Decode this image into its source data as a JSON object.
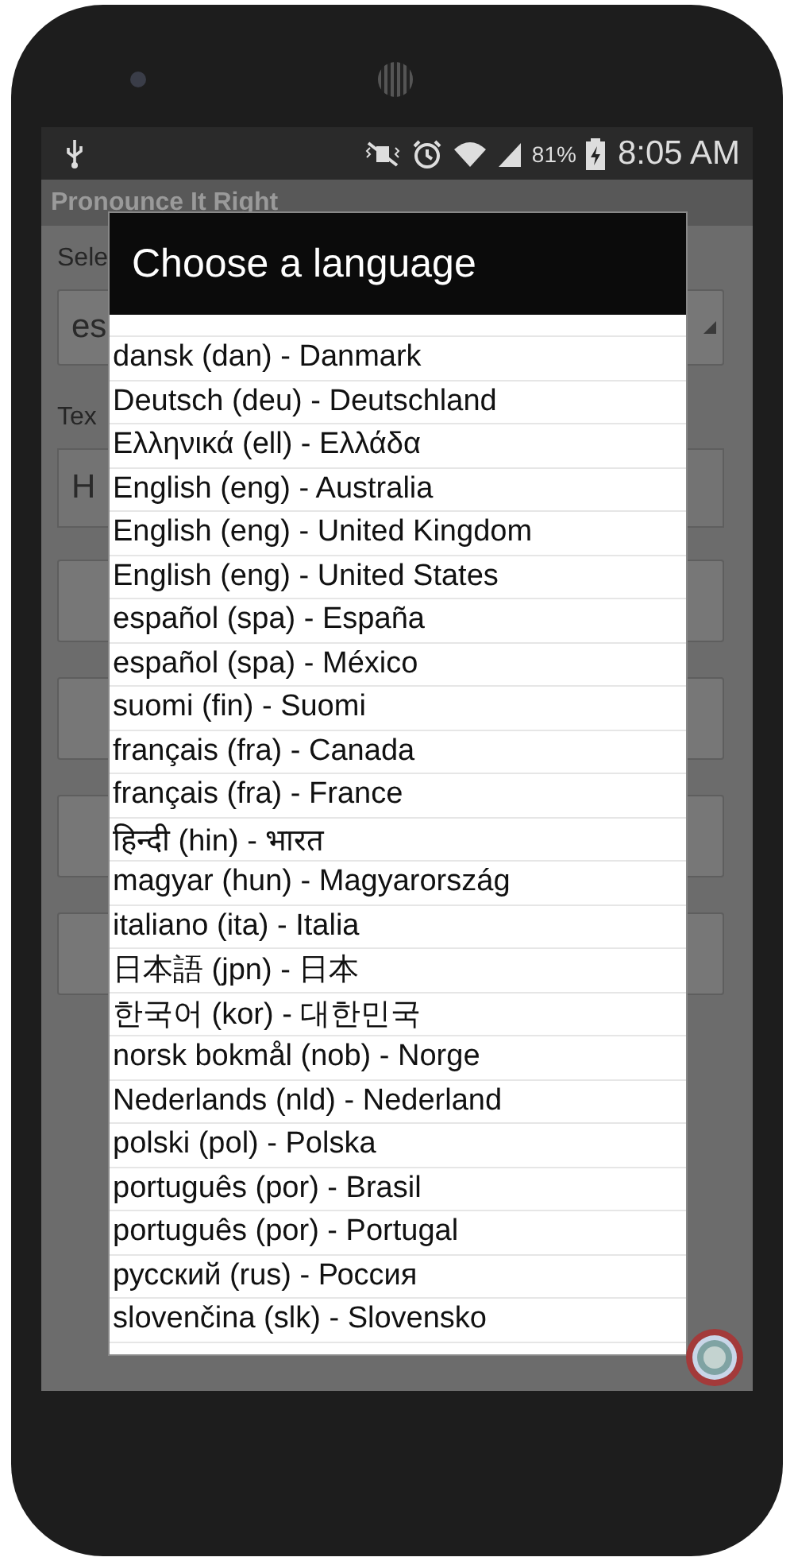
{
  "status_bar": {
    "battery": "81%",
    "time": "8:05 AM"
  },
  "app": {
    "title": "Pronounce It Right",
    "select_label": "Sele",
    "spinner_value": "es",
    "text_label": "Tex",
    "text_value": "H"
  },
  "dialog": {
    "title": "Choose a language",
    "items": [
      "dansk (dan) - Danmark",
      "Deutsch (deu) - Deutschland",
      "Ελληνικά (ell) - Ελλάδα",
      "English (eng) - Australia",
      "English (eng) - United Kingdom",
      "English (eng) - United States",
      "español (spa) - España",
      "español (spa) - México",
      "suomi (fin) - Suomi",
      "français (fra) - Canada",
      "français (fra) - France",
      "हिन्दी (hin) - भारत",
      "magyar (hun) - Magyarország",
      "italiano (ita) - Italia",
      "日本語 (jpn) - 日本",
      "한국어 (kor) - 대한민국",
      "norsk bokmål (nob) - Norge",
      "Nederlands (nld) - Nederland",
      "polski (pol) - Polska",
      "português (por) - Brasil",
      "português (por) - Portugal",
      "русский (rus) - Россия",
      "slovenčina (slk) - Slovensko"
    ]
  }
}
